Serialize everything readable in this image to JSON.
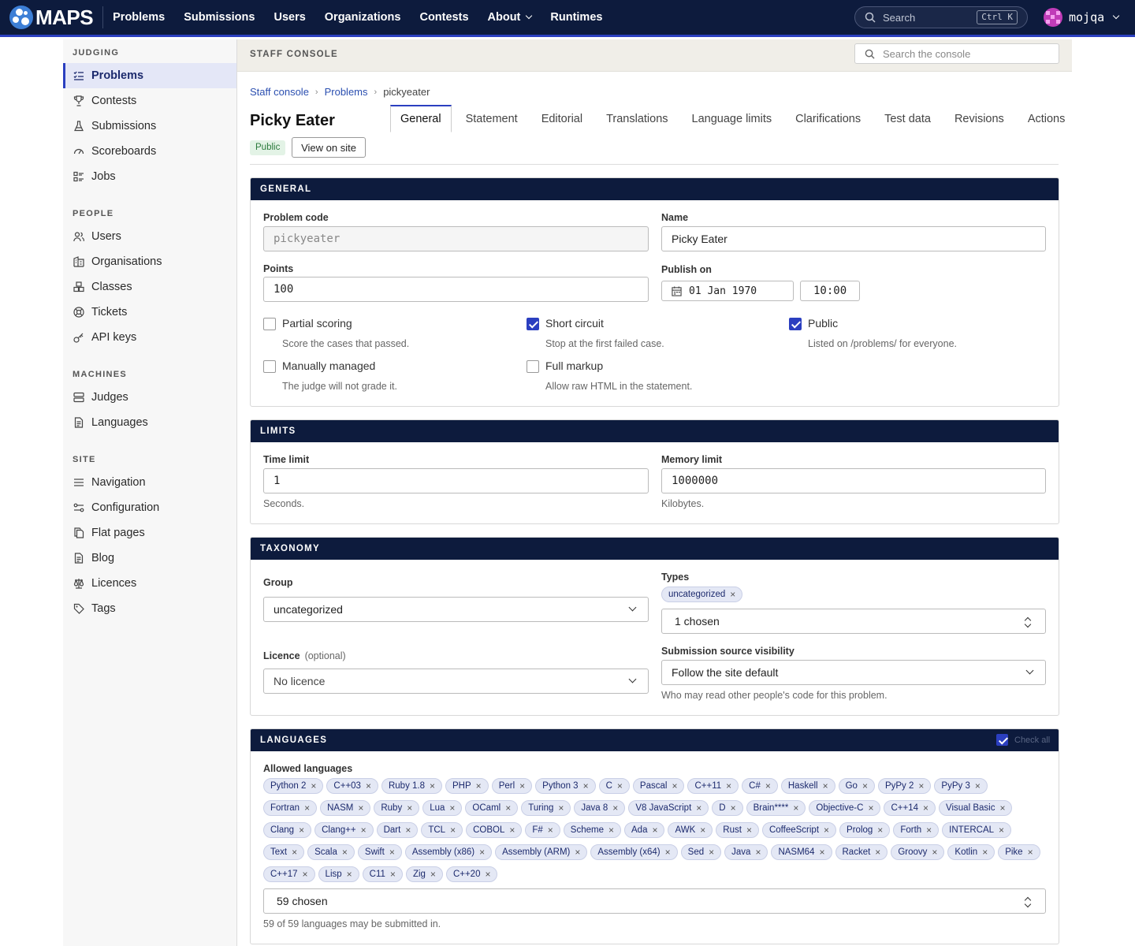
{
  "app": {
    "name": "MAPS"
  },
  "topnav": {
    "items": [
      "Problems",
      "Submissions",
      "Users",
      "Organizations",
      "Contests",
      "About",
      "Runtimes"
    ],
    "search_placeholder": "Search",
    "search_shortcut": "Ctrl K",
    "username": "mojqa"
  },
  "sidebar": {
    "sections": [
      {
        "title": "JUDGING",
        "items": [
          "Problems",
          "Contests",
          "Submissions",
          "Scoreboards",
          "Jobs"
        ]
      },
      {
        "title": "PEOPLE",
        "items": [
          "Users",
          "Organisations",
          "Classes",
          "Tickets",
          "API keys"
        ]
      },
      {
        "title": "MACHINES",
        "items": [
          "Judges",
          "Languages"
        ]
      },
      {
        "title": "SITE",
        "items": [
          "Navigation",
          "Configuration",
          "Flat pages",
          "Blog",
          "Licences",
          "Tags"
        ]
      }
    ],
    "active": "Problems"
  },
  "console": {
    "title": "STAFF CONSOLE",
    "search_placeholder": "Search the console"
  },
  "breadcrumb": [
    "Staff console",
    "Problems",
    "pickyeater"
  ],
  "problem": {
    "title": "Picky Eater",
    "status_badge": "Public",
    "view_button": "View on site"
  },
  "tabs": [
    "General",
    "Statement",
    "Editorial",
    "Translations",
    "Language limits",
    "Clarifications",
    "Test data",
    "Revisions",
    "Actions"
  ],
  "active_tab": "General",
  "general": {
    "heading": "GENERAL",
    "problem_code_label": "Problem code",
    "problem_code": "pickyeater",
    "name_label": "Name",
    "name": "Picky Eater",
    "points_label": "Points",
    "points": "100",
    "publish_label": "Publish on",
    "publish_date": "01 Jan 1970",
    "publish_time": "10:00",
    "checkboxes": [
      {
        "label": "Partial scoring",
        "help": "Score the cases that passed.",
        "checked": false
      },
      {
        "label": "Short circuit",
        "help": "Stop at the first failed case.",
        "checked": true
      },
      {
        "label": "Public",
        "help": "Listed on /problems/ for everyone.",
        "checked": true
      },
      {
        "label": "Manually managed",
        "help": "The judge will not grade it.",
        "checked": false
      },
      {
        "label": "Full markup",
        "help": "Allow raw HTML in the statement.",
        "checked": false
      }
    ]
  },
  "limits": {
    "heading": "LIMITS",
    "time_label": "Time limit",
    "time_value": "1",
    "time_help": "Seconds.",
    "memory_label": "Memory limit",
    "memory_value": "1000000",
    "memory_help": "Kilobytes."
  },
  "taxonomy": {
    "heading": "TAXONOMY",
    "group_label": "Group",
    "group_value": "uncategorized",
    "types_label": "Types",
    "types_chip": "uncategorized",
    "types_chosen": "1 chosen",
    "licence_label": "Licence",
    "licence_optional": "(optional)",
    "licence_value": "No licence",
    "visibility_label": "Submission source visibility",
    "visibility_value": "Follow the site default",
    "visibility_help": "Who may read other people's code for this problem."
  },
  "languages": {
    "heading": "LANGUAGES",
    "check_all": "Check all",
    "allowed_label": "Allowed languages",
    "items": [
      "Python 2",
      "C++03",
      "Ruby 1.8",
      "PHP",
      "Perl",
      "Python 3",
      "C",
      "Pascal",
      "C++11",
      "C#",
      "Haskell",
      "Go",
      "PyPy 2",
      "PyPy 3",
      "Fortran",
      "NASM",
      "Ruby",
      "Lua",
      "OCaml",
      "Turing",
      "Java 8",
      "V8 JavaScript",
      "D",
      "Brain****",
      "Objective-C",
      "C++14",
      "Visual Basic",
      "Clang",
      "Clang++",
      "Dart",
      "TCL",
      "COBOL",
      "F#",
      "Scheme",
      "Ada",
      "AWK",
      "Rust",
      "CoffeeScript",
      "Prolog",
      "Forth",
      "INTERCAL",
      "Text",
      "Scala",
      "Swift",
      "Assembly (x86)",
      "Assembly (ARM)",
      "Assembly (x64)",
      "Sed",
      "Java",
      "NASM64",
      "Racket",
      "Groovy",
      "Kotlin",
      "Pike",
      "C++17",
      "Lisp",
      "C11",
      "Zig",
      "C++20"
    ],
    "chosen": "59 chosen",
    "help": "59 of 59 languages may be submitted in."
  },
  "colors": {
    "navy": "#0d1b3d",
    "accent": "#2b3fc0"
  }
}
